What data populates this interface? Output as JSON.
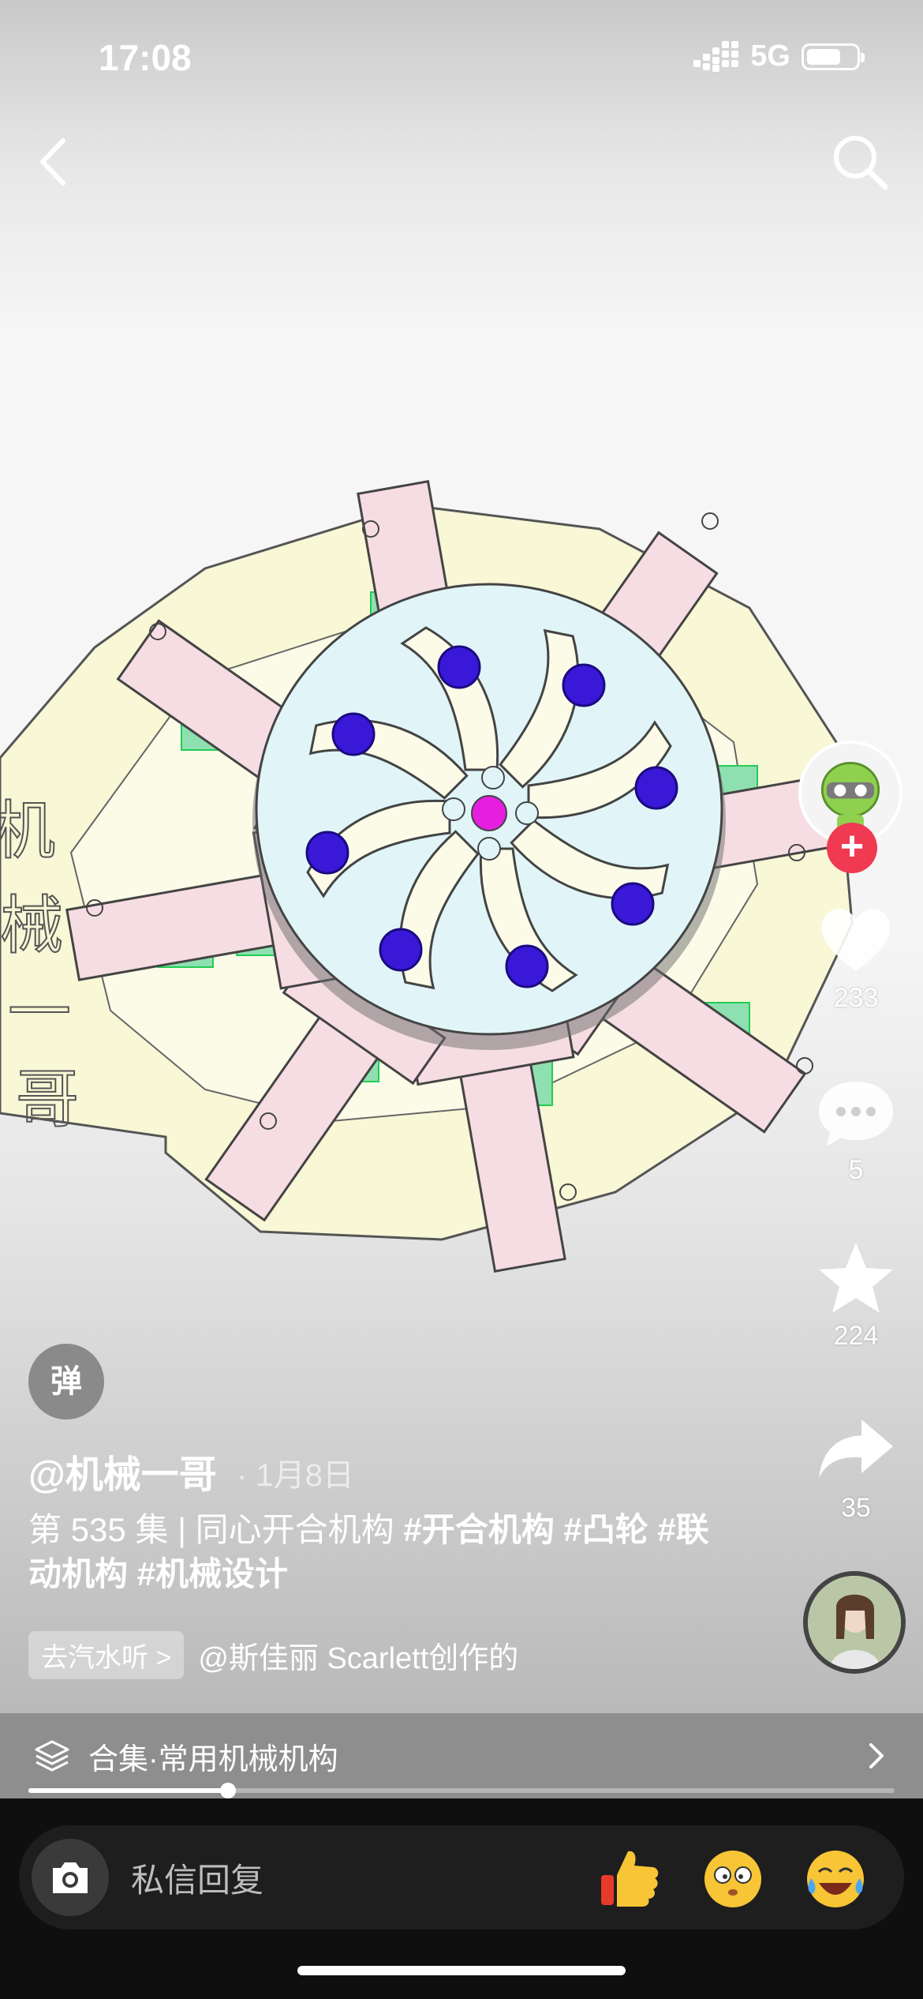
{
  "status": {
    "time": "17:08",
    "network": "5G"
  },
  "video": {
    "watermark": [
      "机",
      "械",
      "一",
      "哥"
    ]
  },
  "rail": {
    "like_count": "233",
    "comment_count": "5",
    "favorite_count": "224",
    "share_count": "35"
  },
  "post": {
    "danmu_label": "弹",
    "author": "@机械一哥",
    "date": "· 1月8日",
    "desc_text": "第 535 集 | 同心开合机构 ",
    "tags": [
      "#开合机构",
      "#凸轮",
      "#联动机构",
      "#机械设计"
    ],
    "music_pill": "去汽水听 >",
    "music_text": "@斯佳丽 Scarlett创作的"
  },
  "collection": {
    "label": "合集·常用机械机构",
    "progress": 0.23
  },
  "comment_bar": {
    "placeholder": "私信回复"
  },
  "colors": {
    "follow": "#f03a52",
    "bar": "#8e8e8e",
    "bottom": "#0f0f0f"
  }
}
